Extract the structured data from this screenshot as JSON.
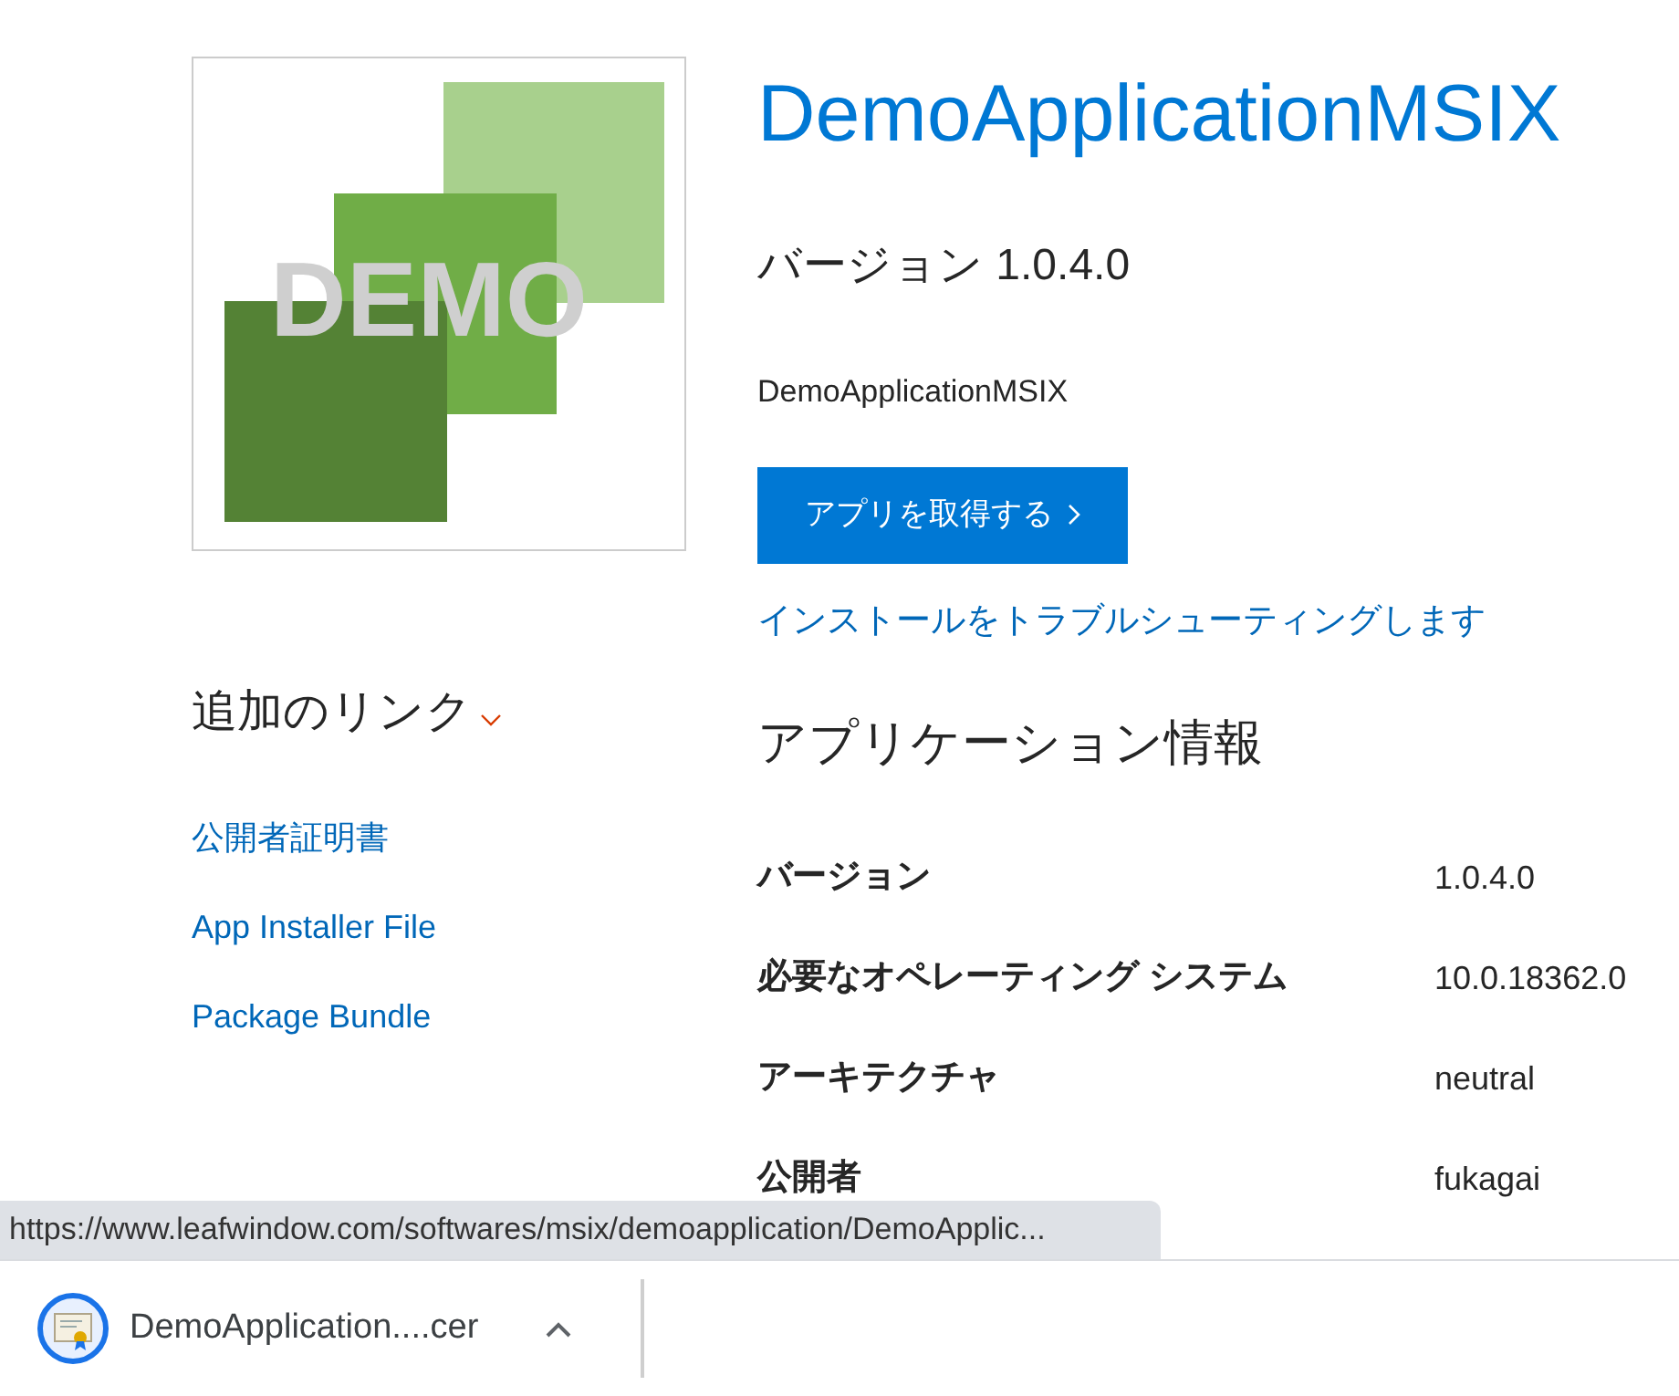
{
  "logo": {
    "text": "DEMO"
  },
  "app": {
    "title": "DemoApplicationMSIX",
    "version": "バージョン 1.0.4.0",
    "publisher_name": "DemoApplicationMSIX",
    "get_button": "アプリを取得する",
    "troubleshoot_link": "インストールをトラブルシューティングします"
  },
  "additional_links": {
    "heading": "追加のリンク",
    "expanded": true,
    "items": [
      {
        "label": "公開者証明書"
      },
      {
        "label": "App Installer File"
      },
      {
        "label": "Package Bundle"
      }
    ]
  },
  "app_info": {
    "heading": "アプリケーション情報",
    "rows": [
      {
        "label": "バージョン",
        "value": "1.0.4.0"
      },
      {
        "label": "必要なオペレーティング システム",
        "value": "10.0.18362.0"
      },
      {
        "label": "アーキテクチャ",
        "value": "neutral"
      },
      {
        "label": "公開者",
        "value": "fukagai"
      }
    ]
  },
  "status_url": "https://www.leafwindow.com/softwares/msix/demoapplication/DemoApplic...",
  "download_bar": {
    "items": [
      {
        "filename": "DemoApplication....cer"
      }
    ]
  }
}
